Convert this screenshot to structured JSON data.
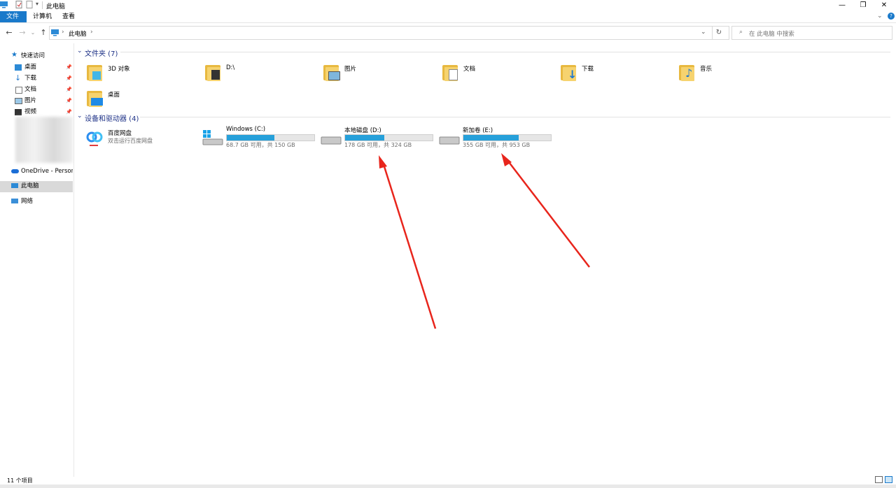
{
  "window": {
    "title": "此电脑"
  },
  "ribbon": {
    "tabs": [
      "文件",
      "计算机",
      "查看"
    ]
  },
  "address": {
    "location": "此电脑",
    "separator": "›",
    "search_placeholder": "在 此电脑 中搜索"
  },
  "nav": {
    "quick_access": "快速访问",
    "items": [
      "桌面",
      "下载",
      "文档",
      "图片",
      "视频"
    ],
    "onedrive": "OneDrive - Persona",
    "this_pc": "此电脑",
    "network": "网络"
  },
  "folders_section": {
    "header": "文件夹 (7)",
    "items": [
      "3D 对象",
      "D:\\",
      "图片",
      "文档",
      "下载",
      "音乐",
      "桌面"
    ]
  },
  "devices_section": {
    "header": "设备和驱动器 (4)",
    "baidu": {
      "name": "百度网盘",
      "desc": "双击运行百度网盘"
    },
    "drives": [
      {
        "name": "Windows (C:)",
        "info": "68.7 GB 可用，共 150 GB",
        "used_fraction": 0.54
      },
      {
        "name": "本地磁盘 (D:)",
        "info": "178 GB 可用，共 324 GB",
        "used_fraction": 0.45
      },
      {
        "name": "新加卷 (E:)",
        "info": "355 GB 可用，共 953 GB",
        "used_fraction": 0.63
      }
    ]
  },
  "status": {
    "count": "11 个项目"
  },
  "colors": {
    "accent": "#1979ca",
    "bar_fill": "#26a0da",
    "annotation": "#e8251c"
  }
}
